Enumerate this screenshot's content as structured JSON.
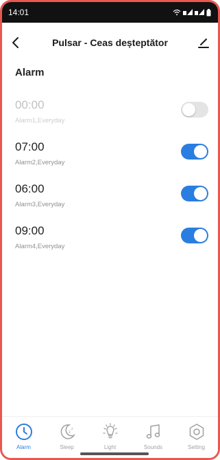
{
  "status_bar": {
    "time": "14:01",
    "icons": [
      "wifi-icon",
      "signal-icon",
      "signal-icon",
      "battery-icon"
    ]
  },
  "header": {
    "back_icon": "chevron-left-icon",
    "title": "Pulsar - Ceas deșteptător",
    "edit_icon": "pencil-icon"
  },
  "section_title": "Alarm",
  "alarms": [
    {
      "time": "00:00",
      "label": "Alarm1,Everyday",
      "enabled": false
    },
    {
      "time": "07:00",
      "label": "Alarm2,Everyday",
      "enabled": true
    },
    {
      "time": "06:00",
      "label": "Alarm3,Everyday",
      "enabled": true
    },
    {
      "time": "09:00",
      "label": "Alarm4,Everyday",
      "enabled": true
    }
  ],
  "tabs": [
    {
      "label": "Alarm",
      "icon": "clock-icon",
      "active": true
    },
    {
      "label": "Sleep",
      "icon": "moon-icon",
      "active": false
    },
    {
      "label": "Light",
      "icon": "light-bulb-icon",
      "active": false
    },
    {
      "label": "Sounds",
      "icon": "music-note-icon",
      "active": false
    },
    {
      "label": "Setting",
      "icon": "gear-icon",
      "active": false
    }
  ],
  "colors": {
    "accent": "#2a7de1",
    "toggle_off": "#e4e4e4",
    "frame_border": "#e8584f",
    "inactive_tab": "#a0a0a0"
  }
}
